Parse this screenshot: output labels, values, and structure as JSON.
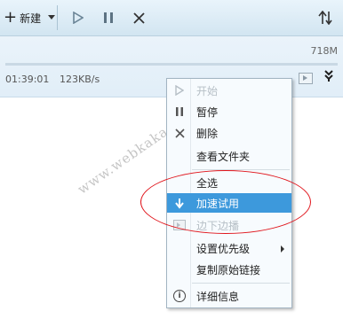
{
  "toolbar": {
    "new_label": "新建",
    "plus_glyph": "+",
    "icons": [
      "plus-icon",
      "chevron-down-icon",
      "play-icon",
      "pause-icon",
      "close-icon",
      "sort-icon"
    ]
  },
  "download": {
    "size": "718M",
    "time": "01:39:01",
    "speed": "123KB/s"
  },
  "watermark": "www.webkaka.com",
  "menu": {
    "items": [
      {
        "label": "开始",
        "icon": "play-icon",
        "disabled": true
      },
      {
        "label": "暂停",
        "icon": "pause-icon",
        "disabled": false
      },
      {
        "label": "删除",
        "icon": "close-icon",
        "disabled": false
      },
      {
        "label": "查看文件夹",
        "icon": "",
        "disabled": false
      },
      {
        "label": "全选",
        "icon": "",
        "disabled": false
      },
      {
        "label": "加速试用",
        "icon": "download-speed-icon",
        "highlighted": true
      },
      {
        "label": "边下边播",
        "icon": "video-icon",
        "disabled": true
      },
      {
        "label": "设置优先级",
        "icon": "",
        "submenu": true
      },
      {
        "label": "复制原始链接",
        "icon": "",
        "disabled": false
      },
      {
        "label": "详细信息",
        "icon": "info-icon",
        "disabled": false
      }
    ]
  },
  "colors": {
    "highlight": "#3d99dc",
    "ellipse": "#e0141b",
    "toolbar_bg": "#dbeaf4"
  }
}
